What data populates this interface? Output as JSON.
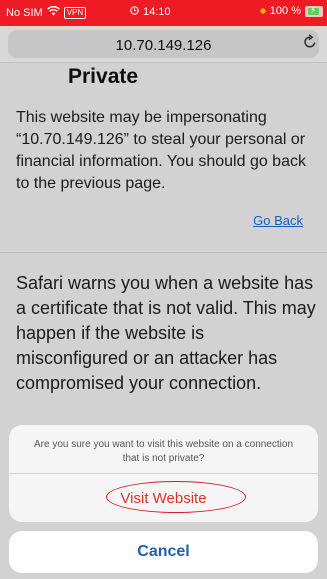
{
  "status_bar": {
    "carrier": "No SIM",
    "wifi_icon": "wifi-icon",
    "vpn_badge": "VPN",
    "time": "14:10",
    "battery_percent": "100 %",
    "background_color": "#ee1b24"
  },
  "url_bar": {
    "address": "10.70.149.126",
    "reload_icon": "reload-icon"
  },
  "page": {
    "title": "Private",
    "warning": "This website may be impersonating “10.70.149.126” to steal your personal or financial information. You should go back to the previous page.",
    "go_back_link": "Go Back",
    "info": "Safari warns you when a website has a certificate that is not valid. This may happen if the website is misconfigured or an attacker has compromised your connection."
  },
  "action_sheet": {
    "message": "Are you sure you want to visit this website on a connection that is not private?",
    "visit_label": "Visit Website",
    "cancel_label": "Cancel",
    "visit_color": "#e0312a",
    "cancel_color": "#1f5fb5"
  }
}
